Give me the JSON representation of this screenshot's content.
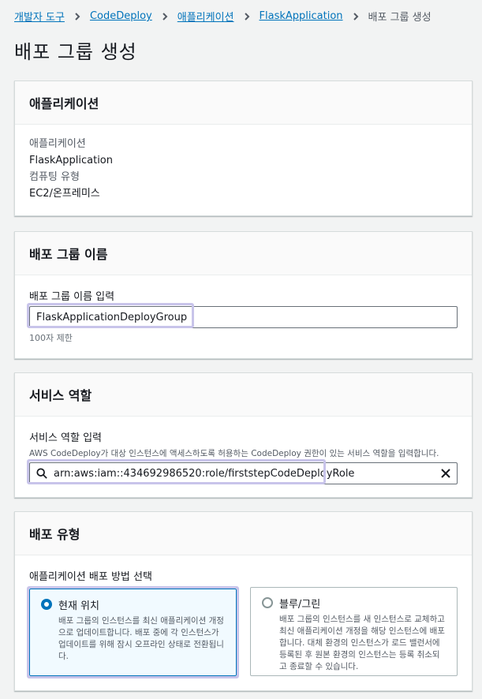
{
  "breadcrumb": {
    "items": [
      "개발자 도구",
      "CodeDeploy",
      "애플리케이션",
      "FlaskApplication"
    ],
    "current": "배포 그룹 생성"
  },
  "page_title": "배포 그룹 생성",
  "application_panel": {
    "title": "애플리케이션",
    "app_key": "애플리케이션",
    "app_value": "FlaskApplication",
    "platform_key": "컴퓨팅 유형",
    "platform_value": "EC2/온프레미스"
  },
  "deployment_group_panel": {
    "title": "배포 그룹 이름",
    "label": "배포 그룹 이름 입력",
    "value": "FlaskApplicationDeployGroup",
    "constraint": "100자 제한"
  },
  "service_role_panel": {
    "title": "서비스 역할",
    "label": "서비스 역할 입력",
    "description": "AWS CodeDeploy가 대상 인스턴스에 액세스하도록 허용하는 CodeDeploy 권한이 있는 서비스 역할을 입력합니다.",
    "value": "arn:aws:iam::434692986520:role/firststepCodeDeployRole"
  },
  "deployment_type_panel": {
    "title": "배포 유형",
    "label": "애플리케이션 배포 방법 선택",
    "options": [
      {
        "title": "현재 위치",
        "description": "배포 그룹의 인스턴스를 최신 애플리케이션 개정으로 업데이트합니다. 배포 중에 각 인스턴스가 업데이트를 위해 잠시 오프라인 상태로 전환됩니다.",
        "selected": true
      },
      {
        "title": "블루/그린",
        "description": "배포 그룹의 인스턴스를 새 인스턴스로 교체하고 최신 애플리케이션 개정을 해당 인스턴스에 배포합니다. 대체 환경의 인스턴스가 로드 밸런서에 등록된 후 원본 환경의 인스턴스는 등록 취소되고 종료할 수 있습니다.",
        "selected": false
      }
    ]
  },
  "colors": {
    "link": "#0073bb",
    "highlight": "#c8c4ea",
    "selected_bg": "#f1faff"
  }
}
